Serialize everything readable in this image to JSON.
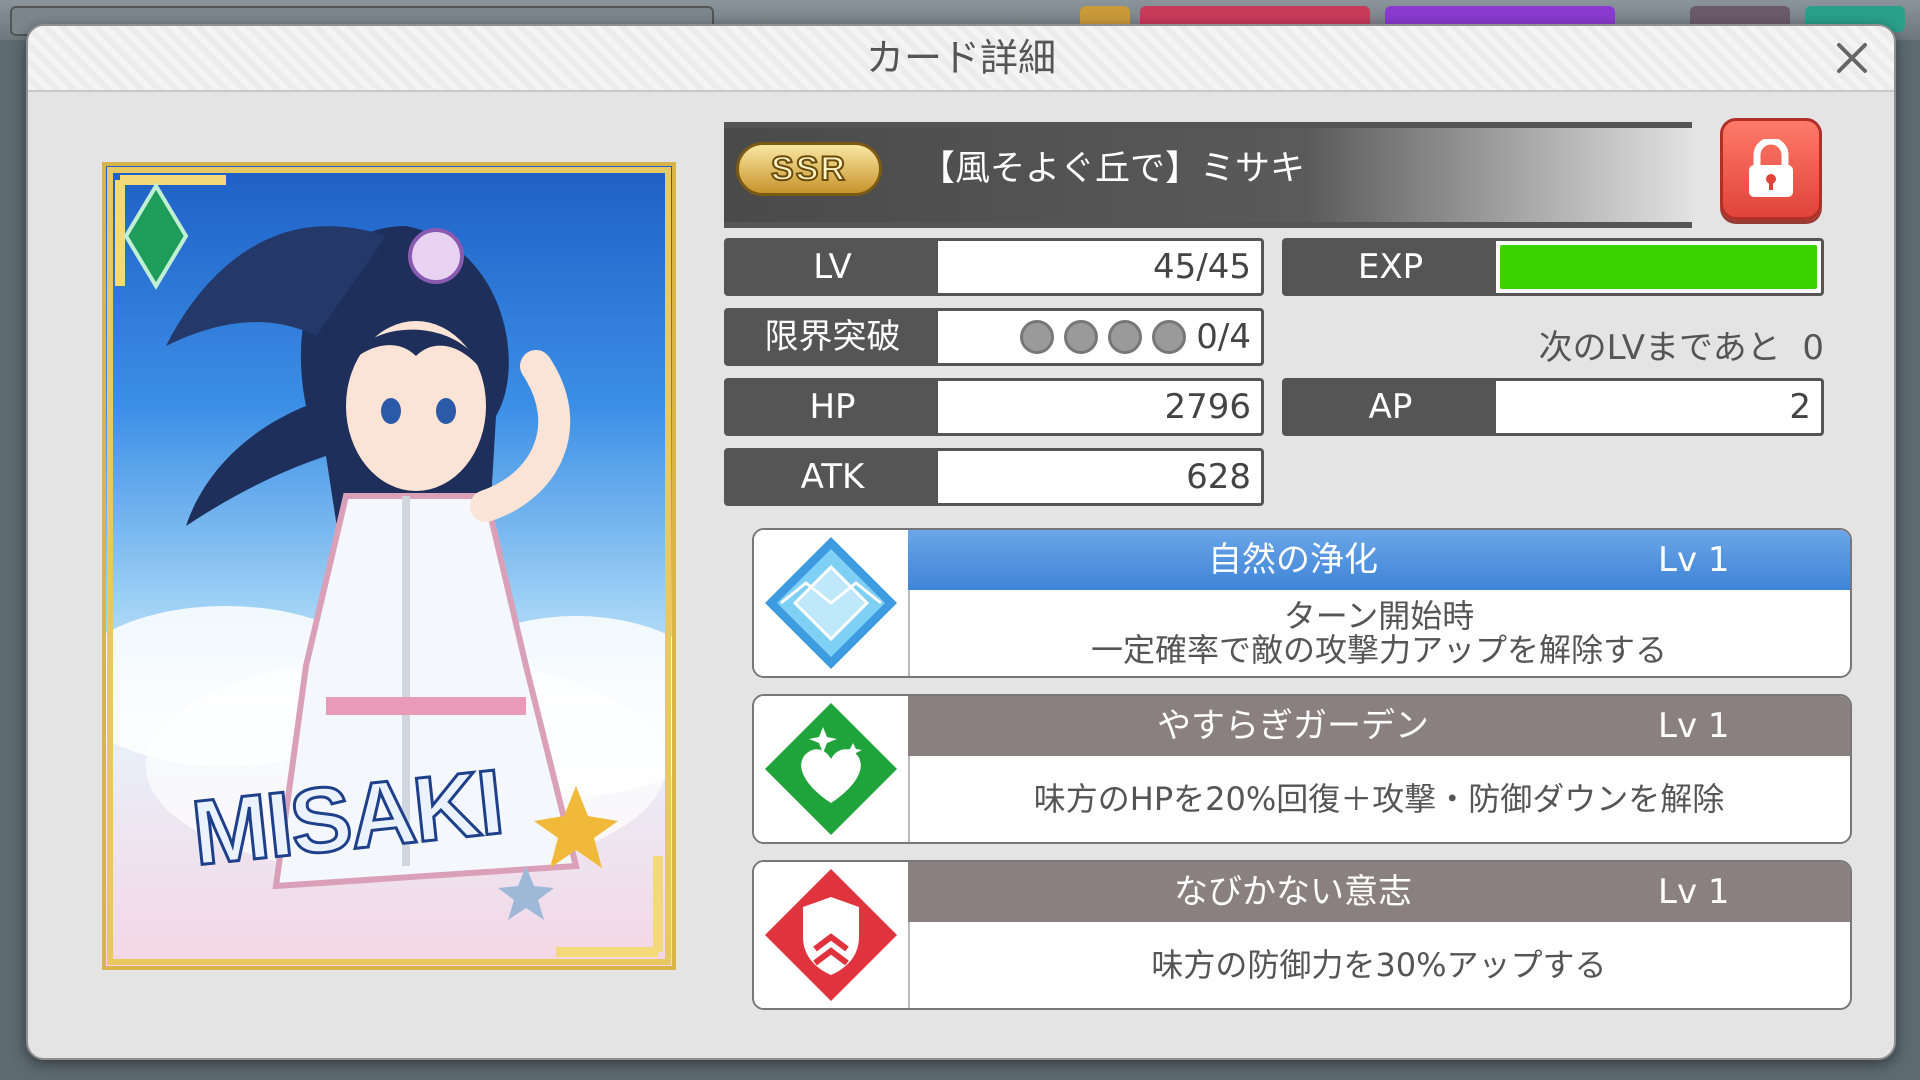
{
  "dialog": {
    "title": "カード詳細"
  },
  "card": {
    "rarity": "SSR",
    "name": "【風そよぐ丘で】ミサキ",
    "art_name": "MISAKI",
    "locked": true
  },
  "stats": {
    "lv_label": "LV",
    "lv_value": "45/45",
    "exp_label": "EXP",
    "exp_fill_percent": 100,
    "limit_label": "限界突破",
    "limit_value": "0/4",
    "limit_slots": 4,
    "next_lv_label": "次のLVまであと",
    "next_lv_value": "0",
    "hp_label": "HP",
    "hp_value": "2796",
    "ap_label": "AP",
    "ap_value": "2",
    "atk_label": "ATK",
    "atk_value": "628"
  },
  "skills": [
    {
      "name": "自然の浄化",
      "level": "Lv 1",
      "desc_line1": "ターン開始時",
      "desc_line2": "一定確率で敵の攻撃力アップを解除する",
      "icon": "blue-diamond-icon",
      "color": "#3f84d6"
    },
    {
      "name": "やすらぎガーデン",
      "level": "Lv 1",
      "desc_line1": "味方のHPを20%回復＋攻撃・防御ダウンを解除",
      "icon": "green-heart-icon",
      "color": "#1fa33a"
    },
    {
      "name": "なびかない意志",
      "level": "Lv 1",
      "desc_line1": "味方の防御力を30%アップする",
      "icon": "red-shield-icon",
      "color": "#e0333e"
    }
  ],
  "colors": {
    "exp_bar": "#39d400",
    "lock_button": "#e0433a",
    "active_skill_header": "#3f84d6",
    "skill_header": "#8a8080"
  }
}
